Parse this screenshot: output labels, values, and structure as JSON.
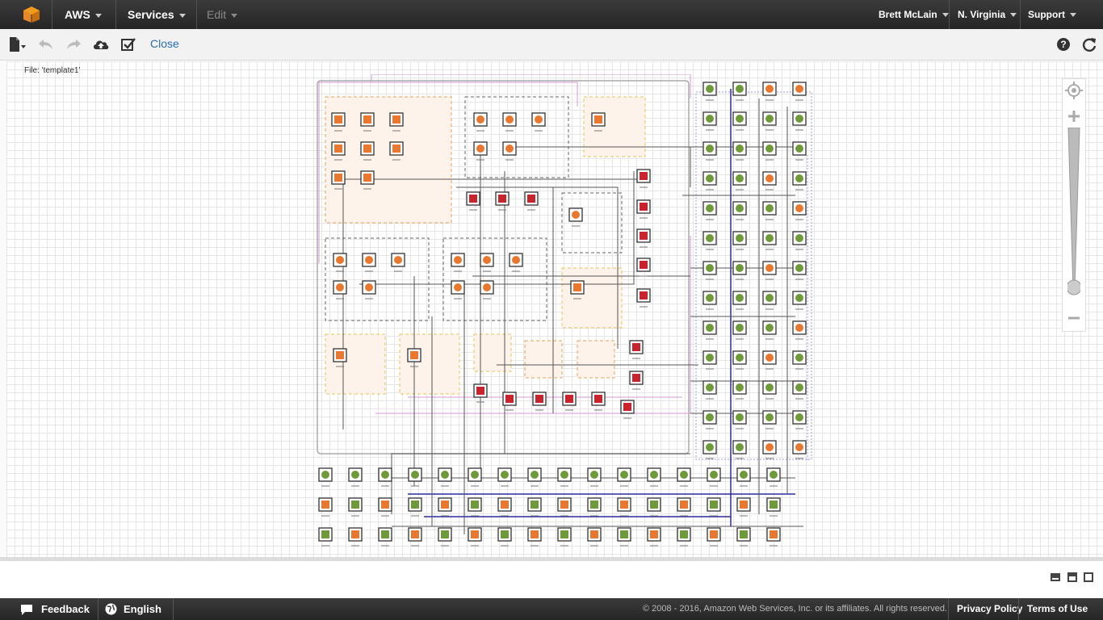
{
  "topnav": {
    "brand": "AWS",
    "services": "Services",
    "edit": "Edit",
    "user": "Brett McLain",
    "region": "N. Virginia",
    "support": "Support"
  },
  "toolbar": {
    "close_label": "Close",
    "file_label": "File: 'template1'"
  },
  "zoom": {
    "level": 0.2
  },
  "footer": {
    "feedback": "Feedback",
    "language": "English",
    "copyright": "© 2008 - 2016, Amazon Web Services, Inc. or its affiliates. All rights reserved.",
    "privacy": "Privacy Policy",
    "terms": "Terms of Use"
  },
  "colors": {
    "nav_bg": "#2b2b2b",
    "link": "#2a6db0",
    "resource_orange": "#e8782f",
    "resource_green": "#6f9a3a",
    "resource_red": "#c9232d",
    "connector_blue": "#2b2b9e",
    "connector_pink": "#d79ad7"
  },
  "icons": [
    "aws-cube-icon",
    "new-file-icon",
    "undo-icon",
    "redo-icon",
    "upload-icon",
    "validate-icon",
    "help-icon",
    "refresh-icon",
    "recenter-icon",
    "zoom-in-icon",
    "zoom-out-icon",
    "feedback-bubble-icon",
    "globe-icon"
  ]
}
